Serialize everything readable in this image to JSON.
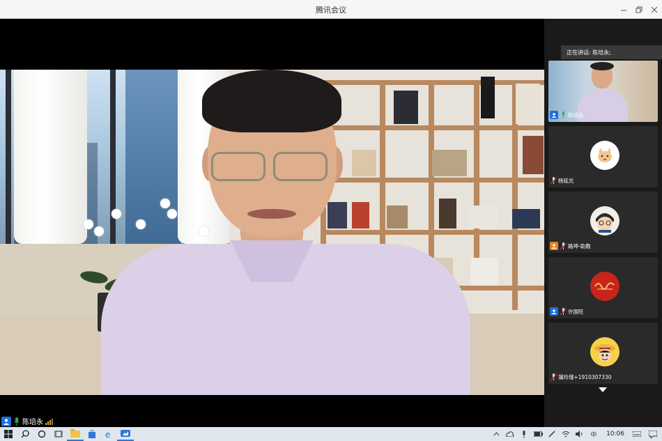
{
  "window": {
    "title": "腾讯会议",
    "controls": [
      "minimize",
      "restore",
      "close"
    ]
  },
  "main_video": {
    "speaker_name": "陈培永",
    "mic_state": "speaking"
  },
  "side_panel": {
    "speaking_label": "正在讲话: 陈培永;",
    "participants": [
      {
        "name": "陈培永",
        "has_video": true,
        "user_icon": "user-icon",
        "avatar": ""
      },
      {
        "name": "杨延光",
        "has_video": false,
        "user_icon": "",
        "avatar": "cat-avatar"
      },
      {
        "name": "路坤-助教",
        "has_video": false,
        "user_icon": "user-icon",
        "avatar": "anime-boy-avatar"
      },
      {
        "name": "许国旺",
        "has_video": false,
        "user_icon": "user-icon",
        "avatar": "red-calligraphy-avatar"
      },
      {
        "name": "蒲玲瑾+1910307330",
        "has_video": false,
        "user_icon": "",
        "avatar": "straw-hat-avatar"
      }
    ]
  },
  "taskbar": {
    "time": "10:06",
    "ime": "中",
    "apps": [
      "file-explorer",
      "store",
      "edge",
      "meeting-app"
    ]
  },
  "colors": {
    "accent": "#1f6fe0",
    "mic_green": "#2cb34a",
    "signal_orange": "#e8a020"
  }
}
